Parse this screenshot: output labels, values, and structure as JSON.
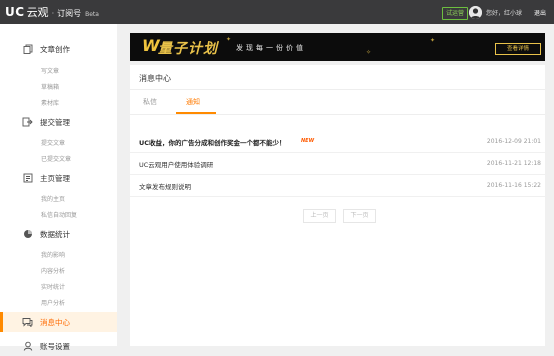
{
  "header": {
    "logo_uc": "UC",
    "logo_cn": "云观",
    "logo_dot": "·",
    "logo_sub": "订阅号",
    "logo_beta": "Beta",
    "trial_badge": "试运营",
    "greeting": "您好，红小球",
    "logout": "退出"
  },
  "sidebar": {
    "sections": [
      {
        "label": "文章创作",
        "icon": "copy-icon",
        "items": [
          "写文章",
          "草稿箱",
          "素材库"
        ]
      },
      {
        "label": "提交管理",
        "icon": "submit-icon",
        "items": [
          "提交文章",
          "已提交文章"
        ]
      },
      {
        "label": "主页管理",
        "icon": "homepage-icon",
        "items": [
          "我的主页",
          "私信自动回复"
        ]
      },
      {
        "label": "数据统计",
        "icon": "chart-icon",
        "items": [
          "我的影响",
          "内容分析",
          "实时统计",
          "用户分析"
        ]
      },
      {
        "label": "消息中心",
        "icon": "message-icon",
        "items": []
      },
      {
        "label": "账号设置",
        "icon": "account-icon",
        "items": []
      }
    ]
  },
  "banner": {
    "w_mark": "W",
    "title": "量子计划",
    "slogan": "发现每一份价值",
    "button": "查看详情"
  },
  "panel": {
    "title": "消息中心",
    "tabs": [
      {
        "label": "私信",
        "active": false
      },
      {
        "label": "通知",
        "active": true
      }
    ],
    "messages": [
      {
        "title": "UC收益，你的广告分成和创作奖金一个都不能少！",
        "new": "NEW",
        "date": "2016-12-09 21:01",
        "bold": true
      },
      {
        "title": "UC云观用户使用体验调研",
        "new": "",
        "date": "2016-11-21 12:18",
        "bold": false
      },
      {
        "title": "文章发布规则说明",
        "new": "",
        "date": "2016-11-16 15:22",
        "bold": false
      }
    ],
    "pager": {
      "prev": "上一页",
      "next": "下一页"
    }
  },
  "colors": {
    "accent": "#ff8a00",
    "topbar": "#3a3a3c",
    "banner_bg": "#0c0c0c",
    "banner_gold": "#e9c24a",
    "new_tag": "#ff5a00"
  }
}
